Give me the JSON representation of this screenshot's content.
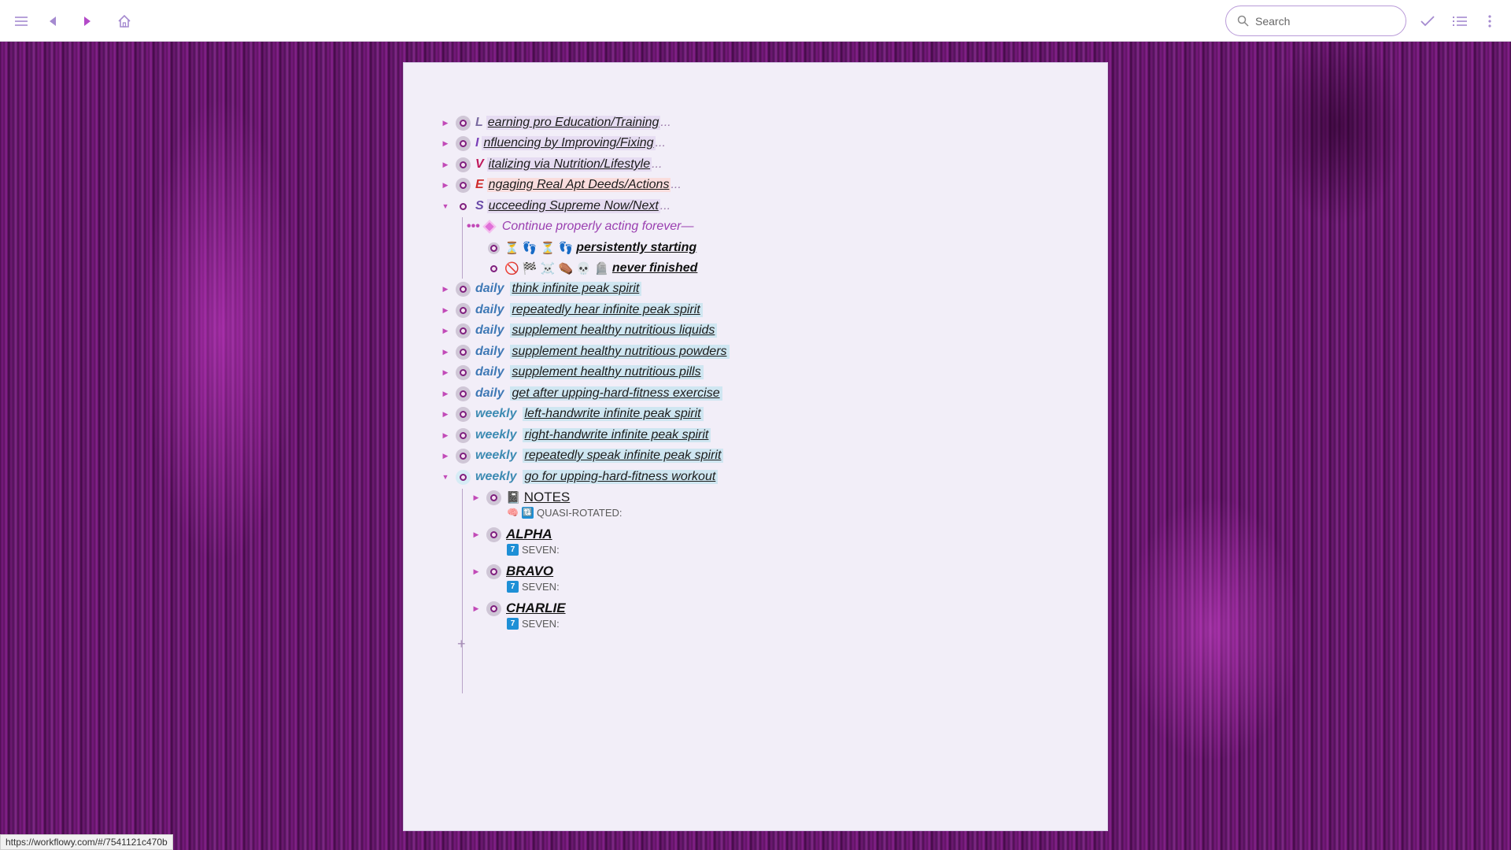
{
  "toolbar": {
    "icons": [
      "menu-icon",
      "back-icon",
      "forward-icon",
      "home-icon",
      "check-icon",
      "list-icon",
      "more-icon"
    ],
    "search_placeholder": "Search"
  },
  "outline": {
    "top_items": [
      {
        "letter": "L",
        "text": "earning pro Education/Training",
        "dots": "...",
        "color": "#7a6aa0"
      },
      {
        "letter": "I",
        "text": "nfluencing by Improving/Fixing",
        "dots": "...",
        "color": "#7a3fb8"
      },
      {
        "letter": "V",
        "text": "italizing via Nutrition/Lifestyle",
        "dots": "...",
        "color": "#c0185a"
      },
      {
        "letter": "E",
        "text": "ngaging Real Apt Deeds/Actions",
        "dots": "...",
        "color": "#d02c2c"
      },
      {
        "letter": "S",
        "text": "ucceeding Supreme Now/Next",
        "dots": "...",
        "color": "#6a4aa8"
      }
    ],
    "s_children": {
      "continue_text": "Continue properly acting forever—",
      "persist_emojis": "⏳ 👣 ⏳ 👣",
      "persist_text": "persistently starting",
      "never_emojis": "🚫 🏁 ☠️ ⚰️ 💀 🪦",
      "never_text": "never finished"
    },
    "habit_items": [
      {
        "tag": "daily",
        "text": "think infinite peak spirit"
      },
      {
        "tag": "daily",
        "text": "repeatedly hear infinite peak spirit"
      },
      {
        "tag": "daily",
        "text": "supplement healthy nutritious liquids"
      },
      {
        "tag": "daily",
        "text": "supplement healthy nutritious powders"
      },
      {
        "tag": "daily",
        "text": "supplement healthy nutritious pills"
      },
      {
        "tag": "daily",
        "text": "get after upping-hard-fitness exercise"
      },
      {
        "tag": "weekly",
        "text": "left-handwrite infinite peak spirit"
      },
      {
        "tag": "weekly",
        "text": "right-handwrite infinite peak spirit"
      },
      {
        "tag": "weekly",
        "text": "repeatedly speak infinite peak spirit"
      },
      {
        "tag": "weekly",
        "text": "go for upping-hard-fitness workout"
      }
    ],
    "workout_children": [
      {
        "emoji": "📓",
        "label": "NOTES",
        "note_emoji": "🧠",
        "note_badge": "🔃",
        "note": "QUASI-ROTATED:"
      },
      {
        "label": "ALPHA",
        "note_badge": "7",
        "note": "SEVEN:"
      },
      {
        "label": "BRAVO",
        "note_badge": "7",
        "note": "SEVEN:"
      },
      {
        "label": "CHARLIE",
        "note_badge": "7",
        "note": "SEVEN:"
      }
    ]
  },
  "status_url": "https://workflowy.com/#/7541121c470b"
}
